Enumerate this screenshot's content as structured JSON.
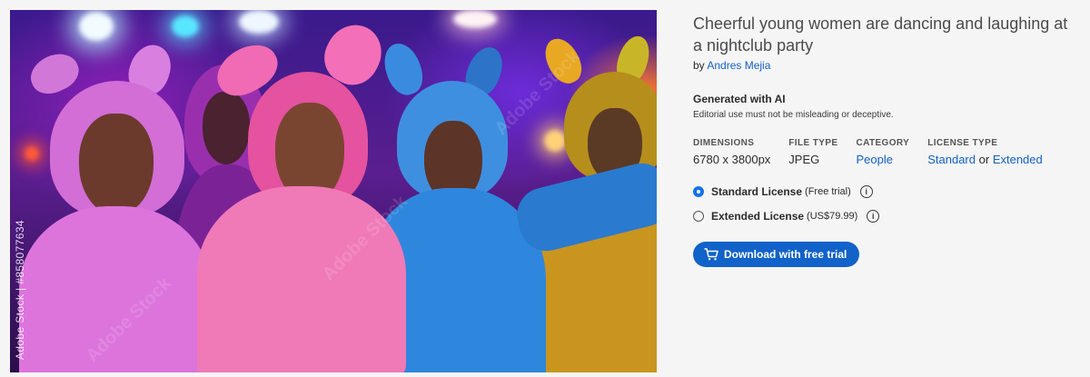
{
  "image": {
    "alt": "Cheerful young women are dancing and laughing at a nightclub party",
    "watermark_id": "Adobe Stock | #858077634",
    "faint_watermark": "Adobe Stock"
  },
  "asset": {
    "title": "Cheerful young women are dancing and laughing at a nightclub party",
    "by_prefix": "by",
    "author": "Andres Mejia",
    "generated_title": "Generated with AI",
    "generated_note": "Editorial use must not be misleading or deceptive."
  },
  "meta": {
    "dimensions_label": "DIMENSIONS",
    "dimensions_value": "6780 x 3800px",
    "file_type_label": "FILE TYPE",
    "file_type_value": "JPEG",
    "category_label": "CATEGORY",
    "category_value": "People",
    "license_type_label": "LICENSE TYPE",
    "license_type_standard": "Standard",
    "license_type_or": "or",
    "license_type_extended": "Extended"
  },
  "licenses": [
    {
      "name": "Standard License",
      "note": "(Free trial)",
      "selected": true
    },
    {
      "name": "Extended License",
      "note": "(US$79.99)",
      "selected": false
    }
  ],
  "download": {
    "label": "Download with free trial",
    "icon": "cart-icon"
  },
  "colors": {
    "accent": "#1461c6",
    "button": "#1162c9",
    "background": "#f5f5f5"
  }
}
